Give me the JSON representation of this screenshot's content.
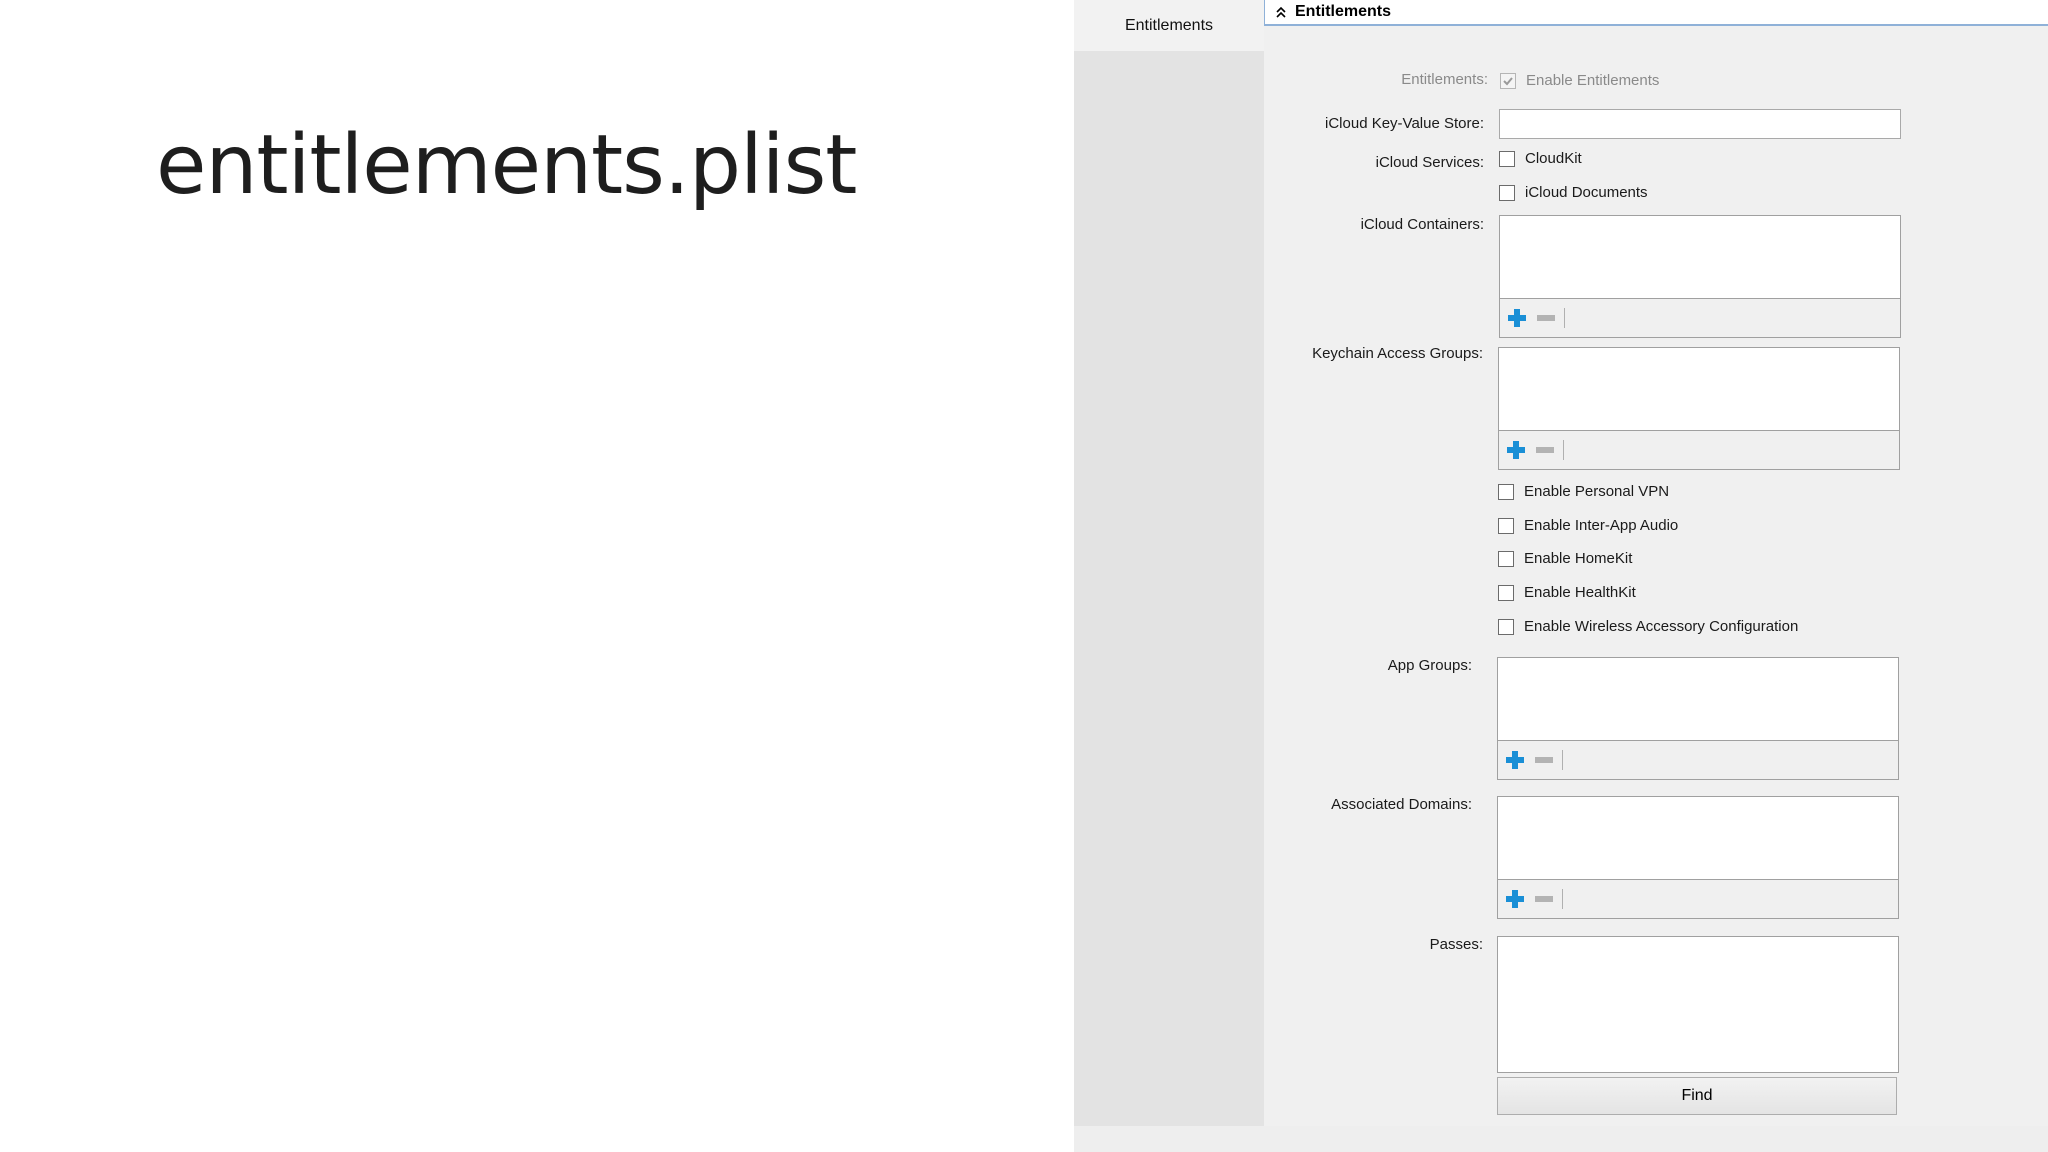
{
  "slide": {
    "title": "entitlements.plist"
  },
  "sidebar": {
    "tab": "Entitlements"
  },
  "section": {
    "title": "Entitlements"
  },
  "form": {
    "entitlements_label": "Entitlements:",
    "enable_entitlements": {
      "label": "Enable Entitlements",
      "checked": true,
      "disabled": true
    },
    "kv_store_label": "iCloud Key-Value Store:",
    "kv_store_value": "",
    "services_label": "iCloud Services:",
    "cloudkit": {
      "label": "CloudKit",
      "checked": false
    },
    "icloud_documents": {
      "label": "iCloud Documents",
      "checked": false
    },
    "containers_label": "iCloud Containers:",
    "keychain_label": "Keychain Access Groups:",
    "personal_vpn": {
      "label": "Enable Personal VPN",
      "checked": false
    },
    "inter_app_audio": {
      "label": "Enable Inter-App Audio",
      "checked": false
    },
    "homekit": {
      "label": "Enable HomeKit",
      "checked": false
    },
    "healthkit": {
      "label": "Enable HealthKit",
      "checked": false
    },
    "wireless_accessory": {
      "label": "Enable Wireless Accessory Configuration",
      "checked": false
    },
    "app_groups_label": "App Groups:",
    "associated_domains_label": "Associated Domains:",
    "passes_label": "Passes:",
    "find_label": "Find"
  },
  "icons": [
    "chevron-up-icon",
    "plus-icon",
    "minus-icon",
    "checkmark-icon"
  ],
  "colors": {
    "accent": "#1a8fd6",
    "header_border": "#8fb1d8",
    "panel": "#f0f0f0",
    "sidebar": "#e3e3e3"
  }
}
